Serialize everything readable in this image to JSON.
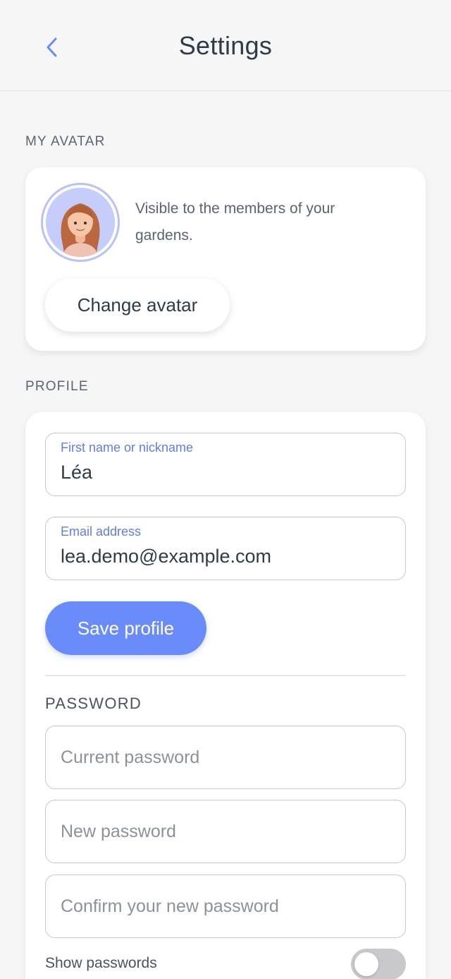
{
  "header": {
    "title": "Settings",
    "back_icon": "chevron-left-icon"
  },
  "avatar_section": {
    "label": "MY AVATAR",
    "description": "Visible to the members of your gardens.",
    "change_button": "Change avatar"
  },
  "profile_section": {
    "label": "PROFILE",
    "first_name": {
      "label": "First name or nickname",
      "value": "Léa"
    },
    "email": {
      "label": "Email address",
      "value": "lea.demo@example.com"
    },
    "save_button": "Save profile"
  },
  "password_section": {
    "label": "PASSWORD",
    "current_placeholder": "Current password",
    "new_placeholder": "New password",
    "confirm_placeholder": "Confirm your new password",
    "show_label": "Show passwords",
    "show_enabled": false
  },
  "colors": {
    "accent": "#6a8bfa",
    "label_blue": "#5f7ee6",
    "background": "#f6f6f6"
  }
}
